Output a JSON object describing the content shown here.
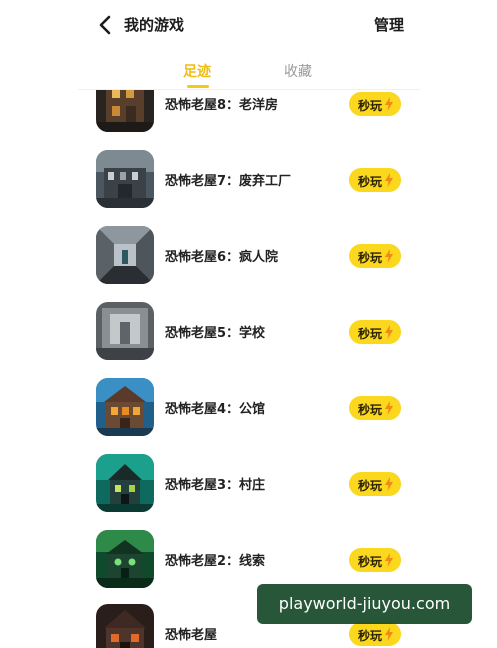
{
  "header": {
    "title": "我的游戏",
    "manage_label": "管理",
    "back_icon": "chevron-left-icon"
  },
  "tabs": [
    {
      "label": "足迹",
      "active": true
    },
    {
      "label": "收藏",
      "active": false
    }
  ],
  "colors": {
    "accent": "#f5c918",
    "play_button": "#fbd71d",
    "watermark_bg": "#164828"
  },
  "games": [
    {
      "name": "恐怖老屋8：老洋房",
      "button": "秒玩",
      "icon": "haunted-mansion-game-icon"
    },
    {
      "name": "恐怖老屋7：废弃工厂",
      "button": "秒玩",
      "icon": "abandoned-factory-game-icon"
    },
    {
      "name": "恐怖老屋6：疯人院",
      "button": "秒玩",
      "icon": "asylum-corridor-game-icon"
    },
    {
      "name": "恐怖老屋5：学校",
      "button": "秒玩",
      "icon": "school-hallway-game-icon"
    },
    {
      "name": "恐怖老屋4：公馆",
      "button": "秒玩",
      "icon": "mansion-game-icon"
    },
    {
      "name": "恐怖老屋3：村庄",
      "button": "秒玩",
      "icon": "village-house-game-icon"
    },
    {
      "name": "恐怖老屋2：线索",
      "button": "秒玩",
      "icon": "clue-house-game-icon"
    },
    {
      "name": "恐怖老屋",
      "button": "秒玩",
      "icon": "old-house-game-icon"
    }
  ],
  "watermark": {
    "text": "playworld-jiuyou.com"
  }
}
